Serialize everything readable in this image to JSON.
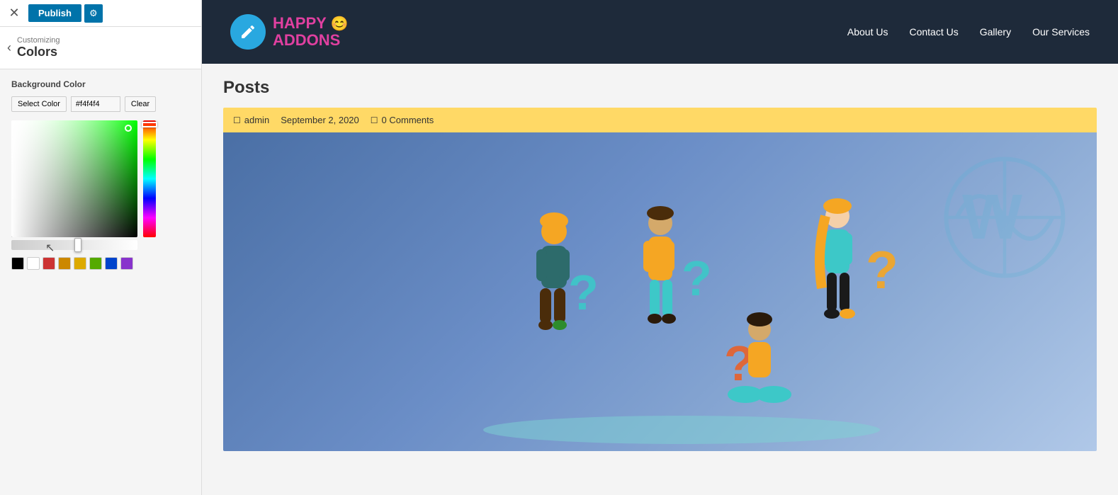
{
  "topbar": {
    "close_label": "✕",
    "publish_label": "Publish",
    "gear_label": "⚙"
  },
  "panel": {
    "back_label": "‹",
    "sub_label": "Customizing",
    "title_label": "Colors",
    "section_label": "Background Color",
    "select_color_btn": "Select Color",
    "color_hex_value": "#f4f4f4",
    "clear_btn": "Clear"
  },
  "swatches": [
    {
      "color": "#000000"
    },
    {
      "color": "#ffffff"
    },
    {
      "color": "#cc3333"
    },
    {
      "color": "#cc8800"
    },
    {
      "color": "#ddaa00"
    },
    {
      "color": "#55aa00"
    },
    {
      "color": "#0044cc"
    },
    {
      "color": "#8833cc"
    }
  ],
  "site": {
    "logo_icon": "✏",
    "logo_happy": "HAPPY 😊",
    "logo_addons": "ADDONS",
    "nav": [
      {
        "label": "About Us"
      },
      {
        "label": "Contact Us"
      },
      {
        "label": "Gallery"
      },
      {
        "label": "Our Services"
      }
    ]
  },
  "page": {
    "title": "Posts",
    "post_meta_icon_user": "□",
    "post_meta_user": "admin",
    "post_meta_date": "September 2, 2020",
    "post_meta_icon_comment": "□",
    "post_meta_comments": "0 Comments"
  }
}
